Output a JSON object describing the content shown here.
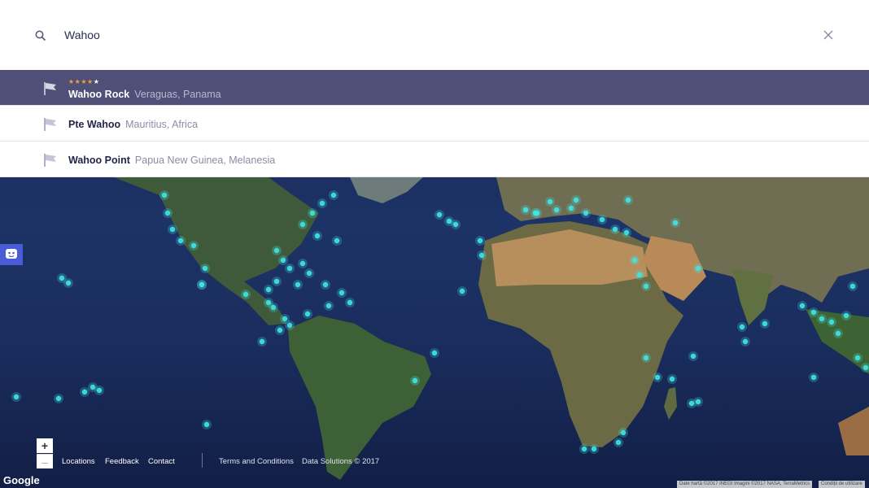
{
  "search": {
    "value": "Wahoo",
    "placeholder": ""
  },
  "results": [
    {
      "name": "Wahoo Rock",
      "location": "Veraguas, Panama",
      "rating": 4,
      "max_rating": 5,
      "selected": true,
      "icon": "flag-icon"
    },
    {
      "name": "Pte Wahoo",
      "location": "Mauritius, Africa",
      "selected": false,
      "icon": "flag-icon"
    },
    {
      "name": "Wahoo Point",
      "location": "Papua New Guinea, Melanesia",
      "selected": false,
      "icon": "flag-icon"
    }
  ],
  "map": {
    "zoom_in_label": "+",
    "zoom_out_label": "–",
    "logo": "Google",
    "attribution": "Date hartă ©2017 INEGI Imagini ©2017 NASA, TerraMetrics",
    "terms_of_use": "Condiții de utilizare"
  },
  "footer": {
    "locations": "Locations",
    "feedback": "Feedback",
    "contact": "Contact",
    "terms": "Terms and Conditions",
    "data_solutions": "Data Solutions © 2017"
  },
  "colors": {
    "selected_row": "#4f4f78",
    "spot_marker": "#3fe6e6",
    "star_filled": "#f2a13b",
    "chat_button": "#4a5bd6"
  },
  "icons": {
    "search": "search-icon",
    "clear": "close-icon",
    "chat": "chat-bot-icon",
    "result": "flag-icon"
  }
}
